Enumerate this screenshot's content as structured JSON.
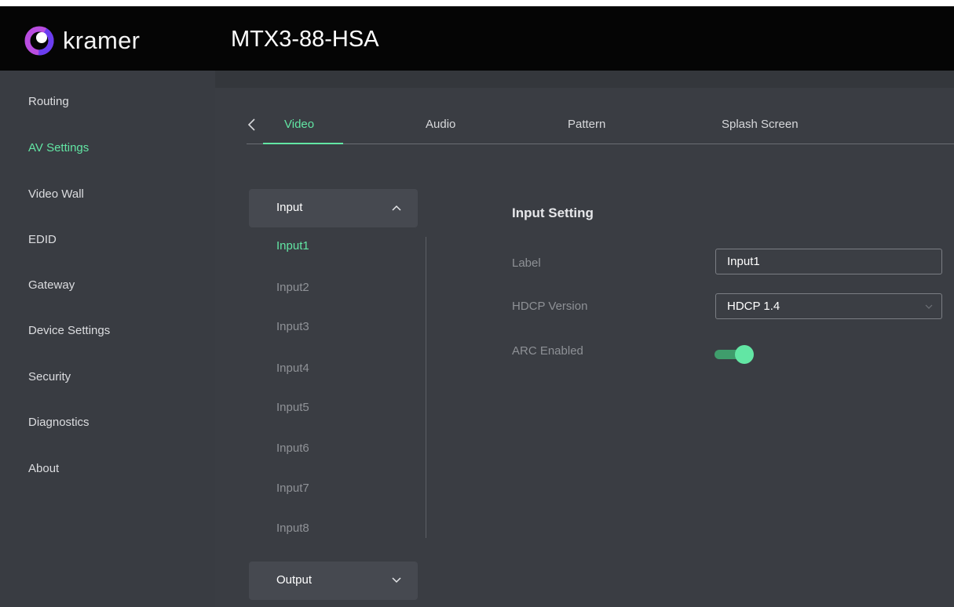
{
  "header": {
    "brand": "kramer",
    "device_name": "MTX3-88-HSA"
  },
  "sidebar": {
    "items": [
      {
        "label": "Routing",
        "active": false
      },
      {
        "label": "AV Settings",
        "active": true
      },
      {
        "label": "Video Wall",
        "active": false
      },
      {
        "label": "EDID",
        "active": false
      },
      {
        "label": "Gateway",
        "active": false
      },
      {
        "label": "Device Settings",
        "active": false
      },
      {
        "label": "Security",
        "active": false
      },
      {
        "label": "Diagnostics",
        "active": false
      },
      {
        "label": "About",
        "active": false
      }
    ]
  },
  "tabs": [
    {
      "label": "Video",
      "active": true
    },
    {
      "label": "Audio",
      "active": false
    },
    {
      "label": "Pattern",
      "active": false
    },
    {
      "label": "Splash Screen",
      "active": false
    }
  ],
  "accordion": {
    "input_header": "Input",
    "input_items": [
      "Input1",
      "Input2",
      "Input3",
      "Input4",
      "Input5",
      "Input6",
      "Input7",
      "Input8"
    ],
    "selected_input": "Input1",
    "output_header": "Output"
  },
  "settings": {
    "title": "Input Setting",
    "label_label": "Label",
    "label_value": "Input1",
    "hdcp_label": "HDCP Version",
    "hdcp_value": "HDCP 1.4",
    "arc_label": "ARC Enabled",
    "arc_enabled": true
  },
  "icons": {
    "logo": "kramer-logo-icon",
    "back": "chevron-left-icon",
    "expand": "chevron-up-icon",
    "collapse": "chevron-down-icon",
    "select": "chevron-down-icon"
  },
  "colors": {
    "accent": "#62e6a4",
    "sidebar_bg": "#393c42",
    "main_bg": "#3a3d43",
    "topbar_bg": "#050505"
  }
}
